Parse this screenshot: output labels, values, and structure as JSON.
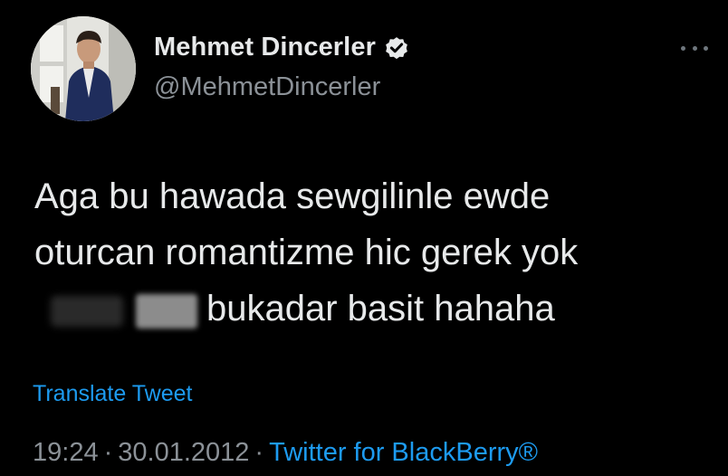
{
  "author": {
    "display_name": "Mehmet Dincerler",
    "handle": "@MehmetDincerler",
    "verified": true,
    "avatar_icon": "profile-photo"
  },
  "more_icon": "more-horizontal-icon",
  "tweet": {
    "lines": [
      "Aga bu hawada sewgilinle ewde",
      "oturcan romantizme hic gerek yok",
      "bukadar basit hahaha"
    ]
  },
  "translate_label": "Translate Tweet",
  "meta": {
    "time": "19:24",
    "separator": "·",
    "date": "30.01.2012",
    "source": "Twitter for BlackBerry®"
  },
  "colors": {
    "background": "#000000",
    "text": "#e7e9ea",
    "muted": "#8b9197",
    "link": "#1d9bf0"
  }
}
